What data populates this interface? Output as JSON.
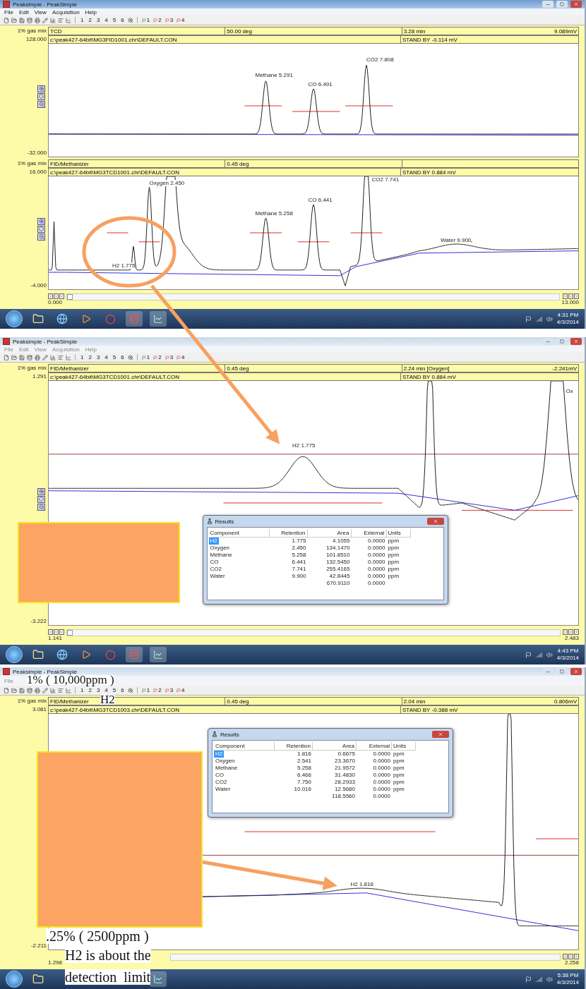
{
  "screens": [
    {
      "window": {
        "title": "Peaksimple - PeakSimple",
        "active": true
      },
      "menu": [
        "File",
        "Edit",
        "View",
        "Acquisition",
        "Help"
      ],
      "toolbar": {
        "numbers": [
          "1",
          "2",
          "3",
          "4",
          "5",
          "6"
        ],
        "channels": [
          "1",
          "2",
          "3",
          "4"
        ]
      },
      "panels": [
        {
          "sample": "1% gas mix",
          "detector": "TCD",
          "temperature": "50.00 deg",
          "time": "3.28 min",
          "signal": "9.089mV",
          "ymax": "128.000",
          "file": "c:\\peak427-64bit\\MG3FID1001.chr\\DEFAULT.CON",
          "status": "STAND BY -0.114 mV",
          "ymin": "-32.000",
          "peaks": [
            {
              "label": "Methane 5.291"
            },
            {
              "label": "CO 6.491"
            },
            {
              "label": "CO2 7.808"
            }
          ]
        },
        {
          "sample": "1% gas mix",
          "detector": "FID/Methanizer",
          "temperature": "0.45 deg",
          "ymax": "16.000",
          "file": "c:\\peak427-64bit\\MG3TCD1001.chr\\DEFAULT.CON",
          "status": "STAND BY 0.884 mV",
          "ymin": "-4.000",
          "peaks": [
            {
              "label": "H2 1.775"
            },
            {
              "label": "Oxygen 2.450"
            },
            {
              "label": "Methane 5.258"
            },
            {
              "label": "CO 6.441"
            },
            {
              "label": "CO2 7.741"
            },
            {
              "label": "Water 9.900"
            }
          ]
        }
      ],
      "xaxis": {
        "start": "0.000",
        "end": "13.000"
      },
      "clock": {
        "time": "4:31 PM",
        "date": "4/3/2014"
      }
    },
    {
      "window": {
        "title": "Peaksimple - PeakSimple",
        "active": false
      },
      "menu": [
        "File",
        "Edit",
        "View",
        "Acquisition",
        "Help"
      ],
      "toolbar": {
        "numbers": [
          "1",
          "2",
          "3",
          "4",
          "5",
          "6"
        ],
        "channels": [
          "1",
          "2",
          "3",
          "4"
        ]
      },
      "panels": [
        {
          "sample": "1% gas mix",
          "detector": "FID/Methanizer",
          "temperature": "0.45 deg",
          "time": "2.24 min [Oxygen]",
          "signal": "-2.241mV",
          "ymax": "1.291",
          "file": "c:\\peak427-64bit\\MG3TCD1001.chr\\DEFAULT.CON",
          "status": "STAND BY 0.884 mV",
          "ymin": "-3.222",
          "peaks": [
            {
              "label": "H2 1.775"
            },
            {
              "label": "Ox"
            }
          ]
        }
      ],
      "xaxis": {
        "start": "1.141",
        "end": "2.483"
      },
      "clock": {
        "time": "4:43 PM",
        "date": "4/3/2014"
      },
      "results": {
        "title": "Results",
        "columns": [
          "Component",
          "Retention",
          "Area",
          "External",
          "Units"
        ],
        "rows": [
          {
            "cells": [
              "H2",
              "1.775",
              "4.1055",
              "0.0000",
              "ppm"
            ],
            "selected": true
          },
          {
            "cells": [
              "Oxygen",
              "2.450",
              "134.1470",
              "0.0000",
              "ppm"
            ],
            "selected": false
          },
          {
            "cells": [
              "Methane",
              "5.258",
              "101.8510",
              "0.0000",
              "ppm"
            ],
            "selected": false
          },
          {
            "cells": [
              "CO",
              "6.441",
              "132.5450",
              "0.0000",
              "ppm"
            ],
            "selected": false
          },
          {
            "cells": [
              "CO2",
              "7.741",
              "255.4165",
              "0.0000",
              "ppm"
            ],
            "selected": false
          },
          {
            "cells": [
              "Water",
              "9.900",
              "42.8445",
              "0.0000",
              "ppm"
            ],
            "selected": false
          }
        ],
        "total": [
          "670.9110",
          "0.0000"
        ]
      }
    },
    {
      "window": {
        "title": "Peaksimple - PeakSimple",
        "active": false
      },
      "menu": [
        "File"
      ],
      "toolbar": {
        "numbers": [
          "1",
          "2",
          "3",
          "4",
          "5",
          "6"
        ],
        "channels": [
          "1",
          "2",
          "3",
          "4"
        ]
      },
      "panels": [
        {
          "sample": "1% gas mix",
          "detector": "FID/Methanizer",
          "temperature": "0.45 deg",
          "time": "2.04 min",
          "signal": "0.806mV",
          "ymax": "3.081",
          "file": "c:\\peak427-64bit\\MG3TCD1003.chr\\DEFAULT.CON",
          "status": "STAND BY -0.388 mV",
          "ymin": "-2.211",
          "peaks": [
            {
              "label": "H2 1.816"
            }
          ]
        }
      ],
      "xaxis": {
        "start": "1.298",
        "end": "2.258"
      },
      "clock": {
        "time": "5:38 PM",
        "date": "4/3/2014"
      },
      "results": {
        "title": "Results",
        "columns": [
          "Component",
          "Retention",
          "Area",
          "External",
          "Units"
        ],
        "rows": [
          {
            "cells": [
              "H2",
              "1.816",
              "0.6675",
              "0.0000",
              "ppm"
            ],
            "selected": true
          },
          {
            "cells": [
              "Oxygen",
              "2.541",
              "23.3670",
              "0.0000",
              "ppm"
            ],
            "selected": false
          },
          {
            "cells": [
              "Methane",
              "5.258",
              "21.9572",
              "0.0000",
              "ppm"
            ],
            "selected": false
          },
          {
            "cells": [
              "CO",
              "6.466",
              "31.4830",
              "0.0000",
              "ppm"
            ],
            "selected": false
          },
          {
            "cells": [
              "CO2",
              "7.750",
              "28.2933",
              "0.0000",
              "ppm"
            ],
            "selected": false
          },
          {
            "cells": [
              "Water",
              "10.016",
              "12.5680",
              "0.0000",
              "ppm"
            ],
            "selected": false
          }
        ],
        "total": [
          "118.5560",
          "0.0000"
        ]
      }
    }
  ],
  "annotations": {
    "top_note": [
      "1% ( 10,000ppm )",
      "H2"
    ],
    "bottom_note": [
      ".25% ( 2500ppm )",
      "H2 is about the",
      "detection  limit"
    ]
  }
}
